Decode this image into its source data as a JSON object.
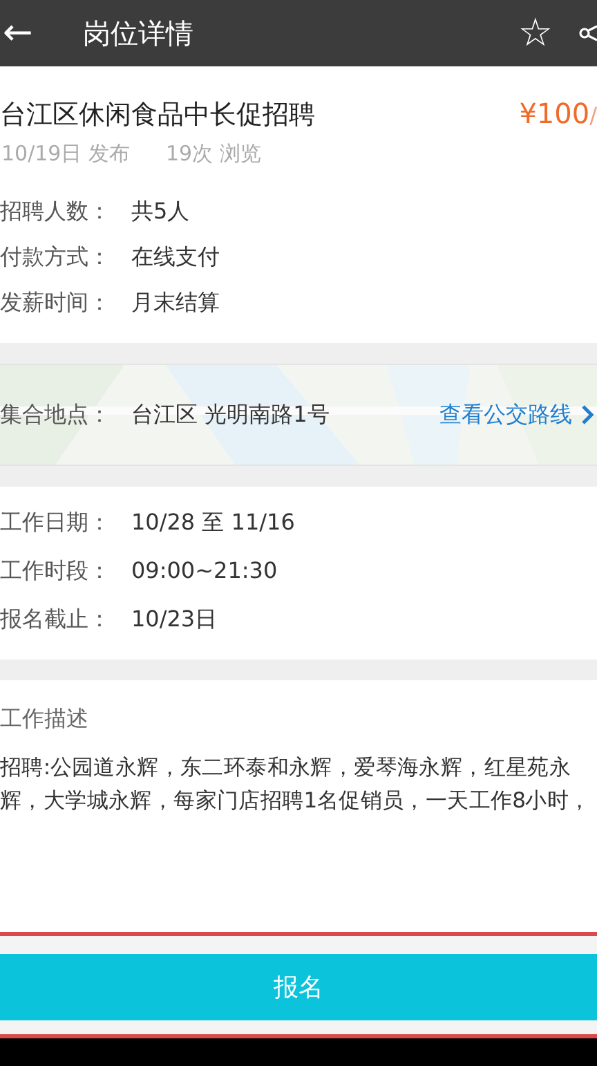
{
  "top_bar": {
    "back": "←",
    "title": "岗位详情",
    "star": "☆"
  },
  "job": {
    "title": "台江区休闲食品中长促招聘",
    "pay": "¥100",
    "pay_unit": "/",
    "published": "10/19日 发布",
    "views": "19次 浏览"
  },
  "info": [
    {
      "label": "招聘人数：",
      "value": "共5人"
    },
    {
      "label": "付款方式：",
      "value": "在线支付"
    },
    {
      "label": "发薪时间：",
      "value": "月末结算"
    }
  ],
  "location": {
    "label": "集合地点：",
    "value": "台江区  光明南路1号",
    "link": "查看公交路线"
  },
  "schedule": [
    {
      "label": "工作日期：",
      "value": "10/28 至  11/16"
    },
    {
      "label": "工作时段：",
      "value": "09:00~21:30"
    },
    {
      "label": "报名截止：",
      "value": "10/23日"
    }
  ],
  "description": {
    "heading": "工作描述",
    "text": "招聘:公园道永辉，东二环泰和永辉，爱琴海永辉，红星苑永辉，大学城永辉，每家门店招聘1名促销员，一天工作8小时，"
  },
  "signup_button": "报名"
}
